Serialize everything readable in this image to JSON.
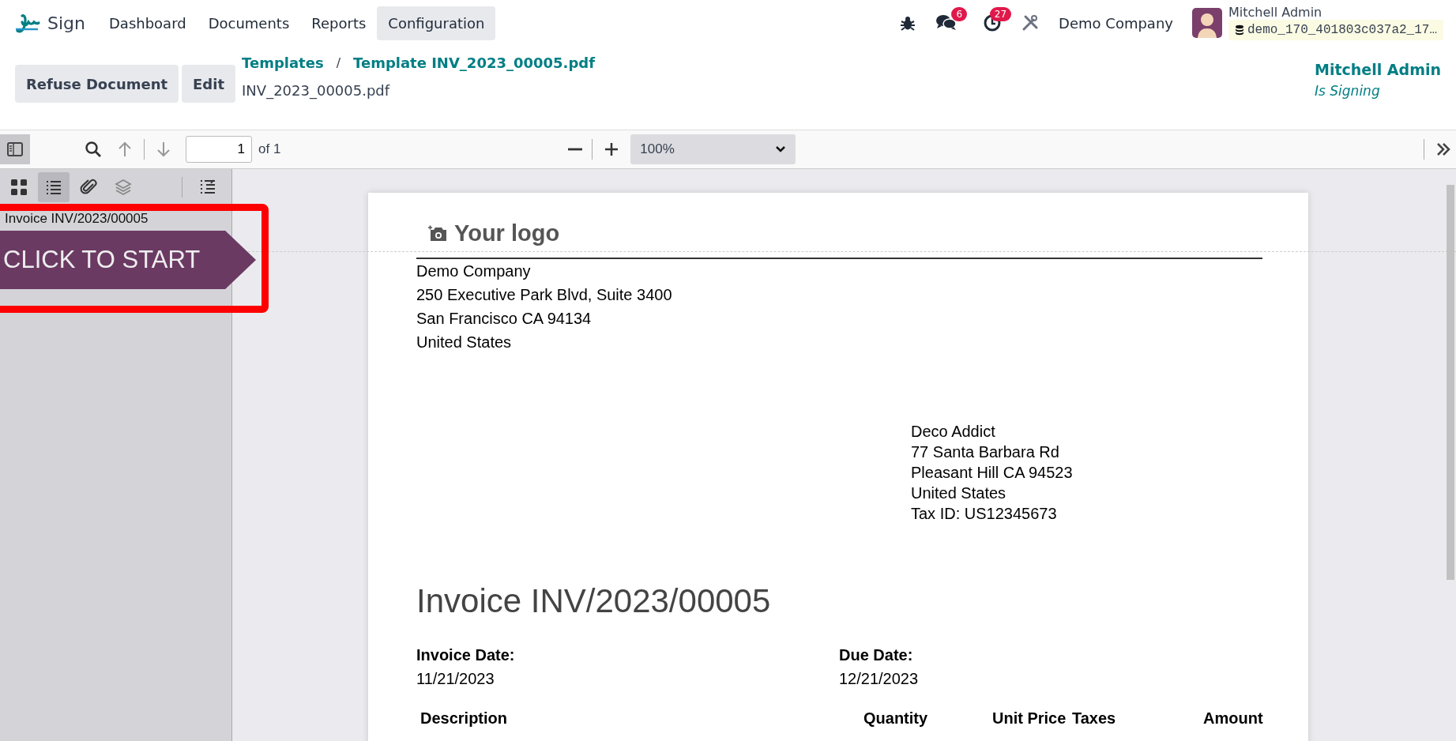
{
  "navbar": {
    "app_name": "Sign",
    "menu": [
      {
        "label": "Dashboard",
        "selected": false
      },
      {
        "label": "Documents",
        "selected": false
      },
      {
        "label": "Reports",
        "selected": false
      },
      {
        "label": "Configuration",
        "selected": true
      }
    ],
    "messages_badge": "6",
    "activities_badge": "27",
    "company": "Demo Company",
    "user": {
      "name": "Mitchell Admin",
      "database": "demo_170_401803c037a2_17…"
    }
  },
  "control_panel": {
    "buttons": [
      "Refuse Document",
      "Edit"
    ],
    "breadcrumbs": [
      "Templates",
      "Template INV_2023_00005.pdf"
    ],
    "breadcrumb_separator": "/",
    "document_name": "INV_2023_00005.pdf",
    "signer": {
      "name": "Mitchell Admin",
      "status": "Is Signing"
    }
  },
  "pdf_toolbar": {
    "page_value": "1",
    "page_count": "of 1",
    "zoom": "100%"
  },
  "sidebar": {
    "views": [
      {
        "kind": "thumbnails",
        "selected": false
      },
      {
        "kind": "outline",
        "selected": true
      },
      {
        "kind": "attachments",
        "selected": false
      },
      {
        "kind": "layers",
        "selected": false
      }
    ],
    "outline": [
      "Invoice INV/2023/00005"
    ],
    "start_marker": "CLICK TO START"
  },
  "document": {
    "logo": "Your logo",
    "company_address": [
      "Demo Company",
      "250 Executive Park Blvd, Suite 3400",
      "San Francisco CA 94134",
      "United States"
    ],
    "customer_address": [
      "Deco Addict",
      "77 Santa Barbara Rd",
      "Pleasant Hill CA 94523",
      "United States",
      "Tax ID: US12345673"
    ],
    "title": "Invoice INV/2023/00005",
    "dates": [
      {
        "label": "Invoice Date:",
        "value": "11/21/2023"
      },
      {
        "label": "Due Date:",
        "value": "12/21/2023"
      }
    ],
    "table_columns": [
      "Description",
      "Quantity",
      "Unit Price",
      "Taxes",
      "Amount"
    ]
  }
}
